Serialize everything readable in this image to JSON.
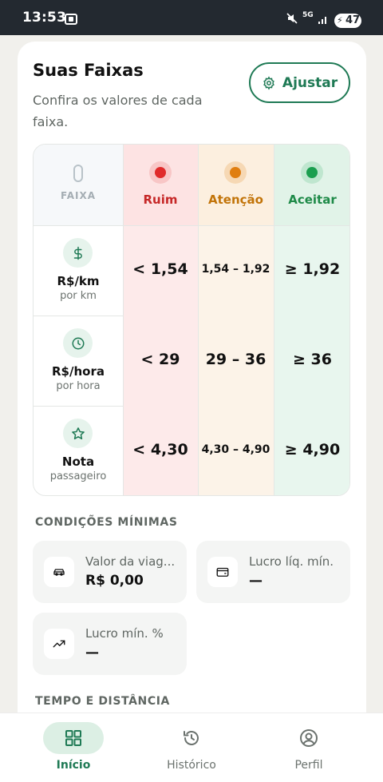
{
  "status_bar": {
    "time": "13:53",
    "network": "5G",
    "battery": "47"
  },
  "header": {
    "title": "Suas Faixas",
    "subtitle": "Confira os valores de cada faixa.",
    "adjust_label": "Ajustar"
  },
  "table": {
    "faixa_label": "FAIXA",
    "columns": {
      "ruim": "Ruim",
      "atencao": "Atenção",
      "aceitar": "Aceitar"
    },
    "rows": [
      {
        "label": "R$/km",
        "sub": "por km",
        "icon": "dollar-icon",
        "ruim": "< 1,54",
        "atencao": "1,54 – 1,92",
        "aceitar": "≥ 1,92"
      },
      {
        "label": "R$/hora",
        "sub": "por hora",
        "icon": "clock-icon",
        "ruim": "< 29",
        "atencao": "29 – 36",
        "aceitar": "≥ 36"
      },
      {
        "label": "Nota",
        "sub": "passageiro",
        "icon": "star-icon",
        "ruim": "< 4,30",
        "atencao": "4,30 – 4,90",
        "aceitar": "≥ 4,90"
      }
    ],
    "colors": {
      "ruim": "#e02a2a",
      "atencao": "#e07e10",
      "aceitar": "#1b9e4f"
    }
  },
  "min_conditions": {
    "title": "CONDIÇÕES MÍNIMAS",
    "items": [
      {
        "label": "Valor da viag...",
        "value": "R$ 0,00",
        "icon": "car-icon"
      },
      {
        "label": "Lucro líq. mín.",
        "value": "—",
        "icon": "wallet-icon"
      },
      {
        "label": "Lucro mín. %",
        "value": "—",
        "icon": "trend-up-icon"
      }
    ]
  },
  "time_distance": {
    "title": "TEMPO E DISTÂNCIA"
  },
  "nav": {
    "items": [
      {
        "label": "Início",
        "icon": "grid-icon",
        "active": true
      },
      {
        "label": "Histórico",
        "icon": "history-icon",
        "active": false
      },
      {
        "label": "Perfil",
        "icon": "profile-icon",
        "active": false
      }
    ]
  },
  "accent_color": "#1f7a55"
}
